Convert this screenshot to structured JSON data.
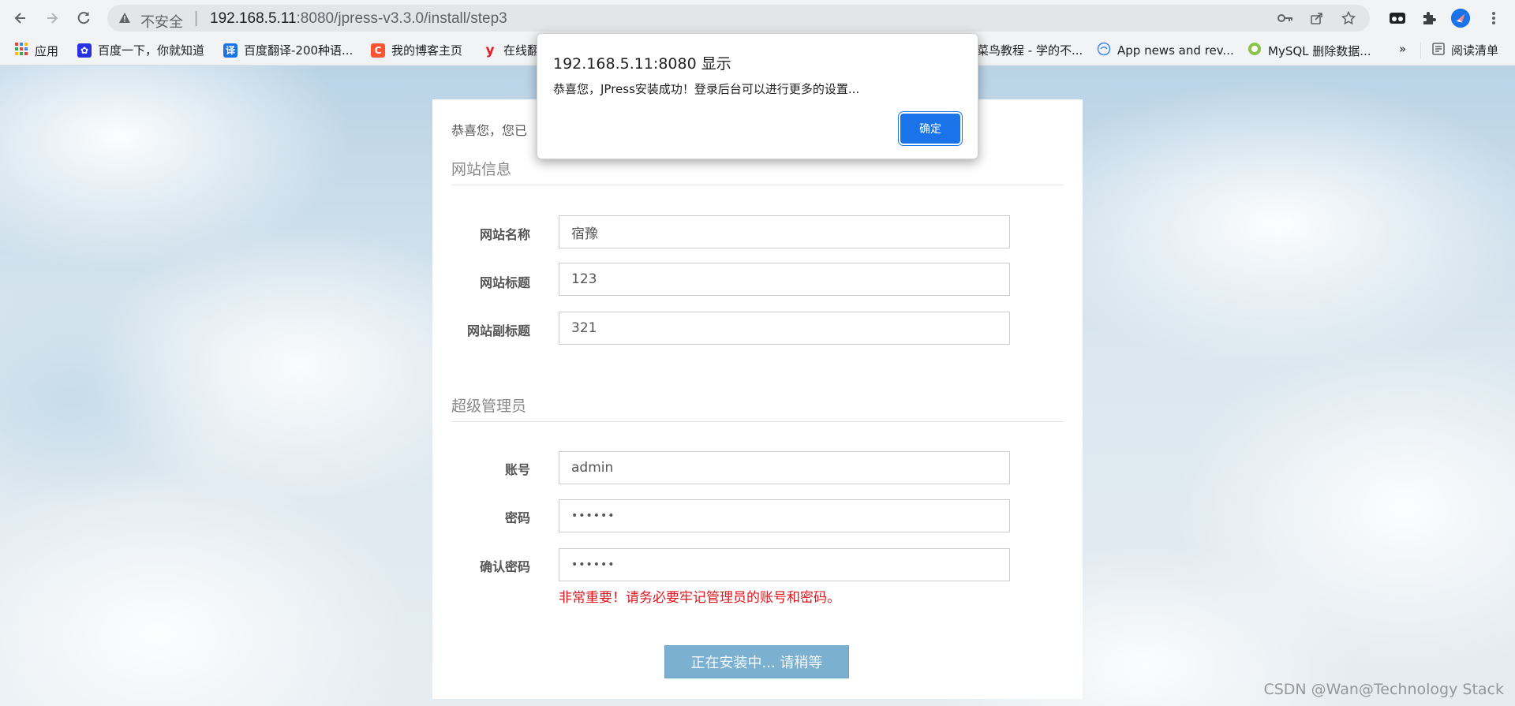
{
  "browser": {
    "security_label": "不安全",
    "url_host": "192.168.5.11",
    "url_rest": ":8080/jpress-v3.3.0/install/step3",
    "icons": [
      "back-icon",
      "forward-icon",
      "reload-icon",
      "warning-icon",
      "key-icon",
      "share-icon",
      "star-icon",
      "extension-icon",
      "puzzle-icon",
      "profile-icon",
      "menu-icon"
    ]
  },
  "bookmarks": [
    {
      "label": "应用",
      "color": "#ea4335"
    },
    {
      "label": "百度一下，你就知道",
      "color": "#2932e1"
    },
    {
      "label": "百度翻译-200种语...",
      "color": "#1a73e8"
    },
    {
      "label": "我的博客主页",
      "color": "#fc5531"
    },
    {
      "label": "在线翻",
      "color": "#e31b23"
    },
    {
      "label": "菜鸟教程 - 学的不...",
      "color": "#5cb85c"
    },
    {
      "label": "App news and rev...",
      "color": "#4285f4"
    },
    {
      "label": "MySQL 删除数据...",
      "color": "#8bc34a"
    },
    {
      "label": "»",
      "color": ""
    },
    {
      "label": "阅读清单",
      "color": "#5f6368"
    }
  ],
  "install": {
    "intro": "恭喜您，您已",
    "site_section": "网站信息",
    "site_fields": [
      {
        "label": "网站名称",
        "value": "宿豫"
      },
      {
        "label": "网站标题",
        "value": "123"
      },
      {
        "label": "网站副标题",
        "value": "321"
      }
    ],
    "admin_section": "超级管理员",
    "admin_fields": [
      {
        "label": "账号",
        "value": "admin"
      },
      {
        "label": "密码",
        "value": "••••••"
      },
      {
        "label": "确认密码",
        "value": "••••••"
      }
    ],
    "warning": "非常重要！请务必要牢记管理员的账号和密码。",
    "button": "正在安装中... 请稍等"
  },
  "dialog": {
    "title": "192.168.5.11:8080 显示",
    "message": "恭喜您，JPress安装成功！登录后台可以进行更多的设置...",
    "ok": "确定"
  },
  "watermark": "CSDN @Wan@Technology Stack"
}
